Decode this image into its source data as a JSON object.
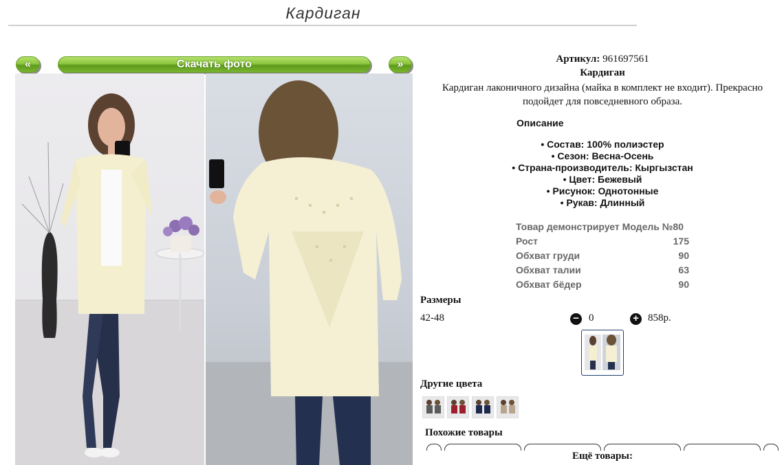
{
  "page": {
    "title": "Кардиган"
  },
  "gallery": {
    "prev_label": "«",
    "download_label": "Скачать фото",
    "next_label": "»"
  },
  "product": {
    "article_label": "Артикул:",
    "article_value": "961697561",
    "name": "Кардиган",
    "description": "Кардиган лаконичного дизайна (майка в комплект не входит). Прекрасно подойдет для повседневного образа.",
    "description_heading": "Описание",
    "properties": [
      "• Состав: 100% полиэстер",
      "• Сезон: Весна-Осень",
      "• Страна-производитель: Кыргызстан",
      "• Цвет: Бежевый",
      "• Рисунок: Однотонные",
      "• Рукав: Длинный"
    ]
  },
  "model": {
    "rows": [
      {
        "label": "Товар демонстрирует Модель №80",
        "value": ""
      },
      {
        "label": "Рост",
        "value": "175"
      },
      {
        "label": "Обхват груди",
        "value": "90"
      },
      {
        "label": "Обхват талии",
        "value": "63"
      },
      {
        "label": "Обхват бёдер",
        "value": "90"
      }
    ]
  },
  "sizes": {
    "heading": "Размеры",
    "size": "42-48",
    "quantity": "0",
    "price": "858р.",
    "minus_icon": "minus-circle-icon",
    "plus_icon": "plus-circle-icon"
  },
  "colors": {
    "heading": "Другие цвета",
    "swatches": [
      "#5b5b5b",
      "#9d1f2c",
      "#1d2a4e",
      "#b9a58e"
    ]
  },
  "similar": {
    "heading": "Похожие товары"
  },
  "more": {
    "heading": "Ещё товары:"
  },
  "theme": {
    "button_green": "#8cc63f",
    "thumb_border": "#1f3f6b"
  }
}
